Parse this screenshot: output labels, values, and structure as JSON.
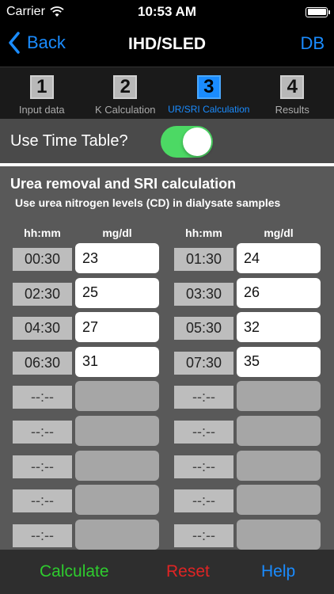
{
  "status": {
    "carrier": "Carrier",
    "time": "10:53 AM"
  },
  "nav": {
    "back_label": "Back",
    "title": "IHD/SLED",
    "right_label": "DB"
  },
  "steps": [
    {
      "num": "1",
      "label": "Input data"
    },
    {
      "num": "2",
      "label": "K Calculation"
    },
    {
      "num": "3",
      "label": "UR/SRI Calculation"
    },
    {
      "num": "4",
      "label": "Results"
    }
  ],
  "toggle": {
    "label": "Use Time Table?",
    "on": true
  },
  "section": {
    "title": "Urea removal and SRI calculation",
    "subtitle": "Use urea nitrogen levels (CD) in dialysate samples",
    "col_time": "hh:mm",
    "col_value": "mg/dl"
  },
  "left_rows": [
    {
      "time": "00:30",
      "value": "23"
    },
    {
      "time": "02:30",
      "value": "25"
    },
    {
      "time": "04:30",
      "value": "27"
    },
    {
      "time": "06:30",
      "value": "31"
    },
    {
      "time": "--:--",
      "value": ""
    },
    {
      "time": "--:--",
      "value": ""
    },
    {
      "time": "--:--",
      "value": ""
    },
    {
      "time": "--:--",
      "value": ""
    },
    {
      "time": "--:--",
      "value": ""
    }
  ],
  "right_rows": [
    {
      "time": "01:30",
      "value": "24"
    },
    {
      "time": "03:30",
      "value": "26"
    },
    {
      "time": "05:30",
      "value": "32"
    },
    {
      "time": "07:30",
      "value": "35"
    },
    {
      "time": "--:--",
      "value": ""
    },
    {
      "time": "--:--",
      "value": ""
    },
    {
      "time": "--:--",
      "value": ""
    },
    {
      "time": "--:--",
      "value": ""
    },
    {
      "time": "--:--",
      "value": ""
    }
  ],
  "bottom": {
    "calculate": "Calculate",
    "reset": "Reset",
    "help": "Help"
  },
  "colors": {
    "accent": "#1a8cff",
    "toggle_on": "#4cd964",
    "calculate": "#2ecc2e",
    "reset": "#e02424",
    "help": "#1a8cff"
  }
}
